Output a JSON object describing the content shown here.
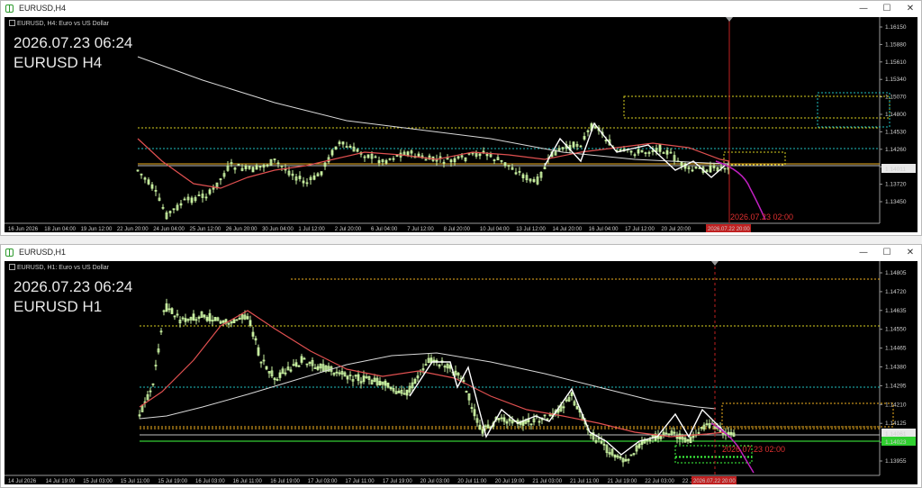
{
  "windows": [
    {
      "title": "EURUSD,H4",
      "symbol_desc": "EURUSD, H4: Euro vs US Dollar",
      "stamp_date": "2026.07.23 06:24",
      "stamp_symbol": "EURUSD H4",
      "price_labels": [
        "1.16150",
        "1.15880",
        "1.15610",
        "1.15340",
        "1.15070",
        "1.14800",
        "1.14530",
        "1.14260",
        "1.13990",
        "1.13720",
        "1.13450"
      ],
      "price_range": [
        1.1332,
        1.163
      ],
      "current_price": "1.14011",
      "time_labels": [
        "16 Jun 2026",
        "18 Jun 04:00",
        "19 Jun 12:00",
        "22 Jun 20:00",
        "24 Jun 04:00",
        "25 Jun 12:00",
        "26 Jun 20:00",
        "30 Jun 04:00",
        "1 Jul 12:00",
        "2 Jul 20:00",
        "6 Jul 04:00",
        "7 Jul 12:00",
        "8 Jul 20:00",
        "10 Jul 04:00",
        "13 Jul 12:00",
        "14 Jul 20:00",
        "16 Jul 04:00",
        "17 Jul 12:00",
        "20 Jul 20:00",
        "2026.07.22 20:00"
      ],
      "annotation": "2026.07.23 02:00"
    },
    {
      "title": "EURUSD,H1",
      "symbol_desc": "EURUSD, H1: Euro vs US Dollar",
      "stamp_date": "2026.07.23 06:24",
      "stamp_symbol": "EURUSD H1",
      "price_labels": [
        "1.14805",
        "1.14720",
        "1.14635",
        "1.14550",
        "1.14465",
        "1.14380",
        "1.14295",
        "1.14210",
        "1.14125",
        "1.14040",
        "1.13955"
      ],
      "price_range": [
        1.1387,
        1.1486
      ],
      "current_price": "1.14061",
      "current_price_green": "1.14023",
      "time_labels": [
        "14 Jul 2026",
        "14 Jul 19:00",
        "15 Jul 03:00",
        "15 Jul 11:00",
        "15 Jul 19:00",
        "16 Jul 03:00",
        "16 Jul 11:00",
        "16 Jul 19:00",
        "17 Jul 03:00",
        "17 Jul 11:00",
        "17 Jul 19:00",
        "20 Jul 03:00",
        "20 Jul 11:00",
        "20 Jul 19:00",
        "21 Jul 03:00",
        "21 Jul 11:00",
        "21 Jul 19:00",
        "22 Jul 03:00",
        "22 Jul 1",
        "2026.07.22 20:00"
      ],
      "annotation": "2026.07.23 02:00"
    }
  ],
  "controls": {
    "minimize": "—",
    "maximize": "☐",
    "close": "✕"
  },
  "colors": {
    "bg": "#000000",
    "candle": "#c8f0a0",
    "ema": "#e05050",
    "sma": "#d8d8d8",
    "zigzag": "#ffffff",
    "forecast": "#c020c0",
    "level": "#f0b020",
    "dotted": "#d8d020",
    "cyan": "#20c0c0",
    "green": "#40ff40",
    "vline": "#c02020"
  }
}
